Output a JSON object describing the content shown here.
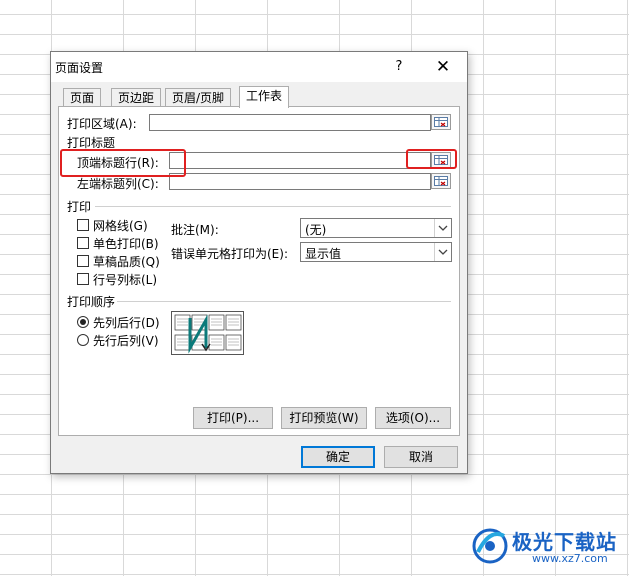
{
  "dialog": {
    "title": "页面设置",
    "help": "?",
    "close": "✕"
  },
  "tabs": [
    {
      "label": "页面",
      "active": false
    },
    {
      "label": "页边距",
      "active": false
    },
    {
      "label": "页眉/页脚",
      "active": false
    },
    {
      "label": "工作表",
      "active": true
    }
  ],
  "print_area": {
    "label": "打印区域(A):",
    "value": ""
  },
  "print_titles": {
    "section": "打印标题",
    "top_rows_label": "顶端标题行(R):",
    "top_rows_value": "",
    "left_cols_label": "左端标题列(C):",
    "left_cols_value": ""
  },
  "print": {
    "section": "打印",
    "checkboxes": [
      {
        "label": "网格线(G)",
        "checked": false
      },
      {
        "label": "单色打印(B)",
        "checked": false
      },
      {
        "label": "草稿品质(Q)",
        "checked": false
      },
      {
        "label": "行号列标(L)",
        "checked": false
      }
    ],
    "comments_label": "批注(M):",
    "comments_value": "(无)",
    "errors_label": "错误单元格打印为(E):",
    "errors_value": "显示值"
  },
  "page_order": {
    "section": "打印顺序",
    "options": [
      {
        "label": "先列后行(D)",
        "checked": true
      },
      {
        "label": "先行后列(V)",
        "checked": false
      }
    ]
  },
  "buttons": {
    "print": "打印(P)...",
    "preview": "打印预览(W)",
    "options": "选项(O)...",
    "ok": "确定",
    "cancel": "取消"
  },
  "watermark": {
    "brand": "极光下载站",
    "url": "www.xz7.com"
  },
  "colors": {
    "highlight": "#e02020",
    "accent": "#0078d7",
    "watermark": "#1a63c4"
  }
}
